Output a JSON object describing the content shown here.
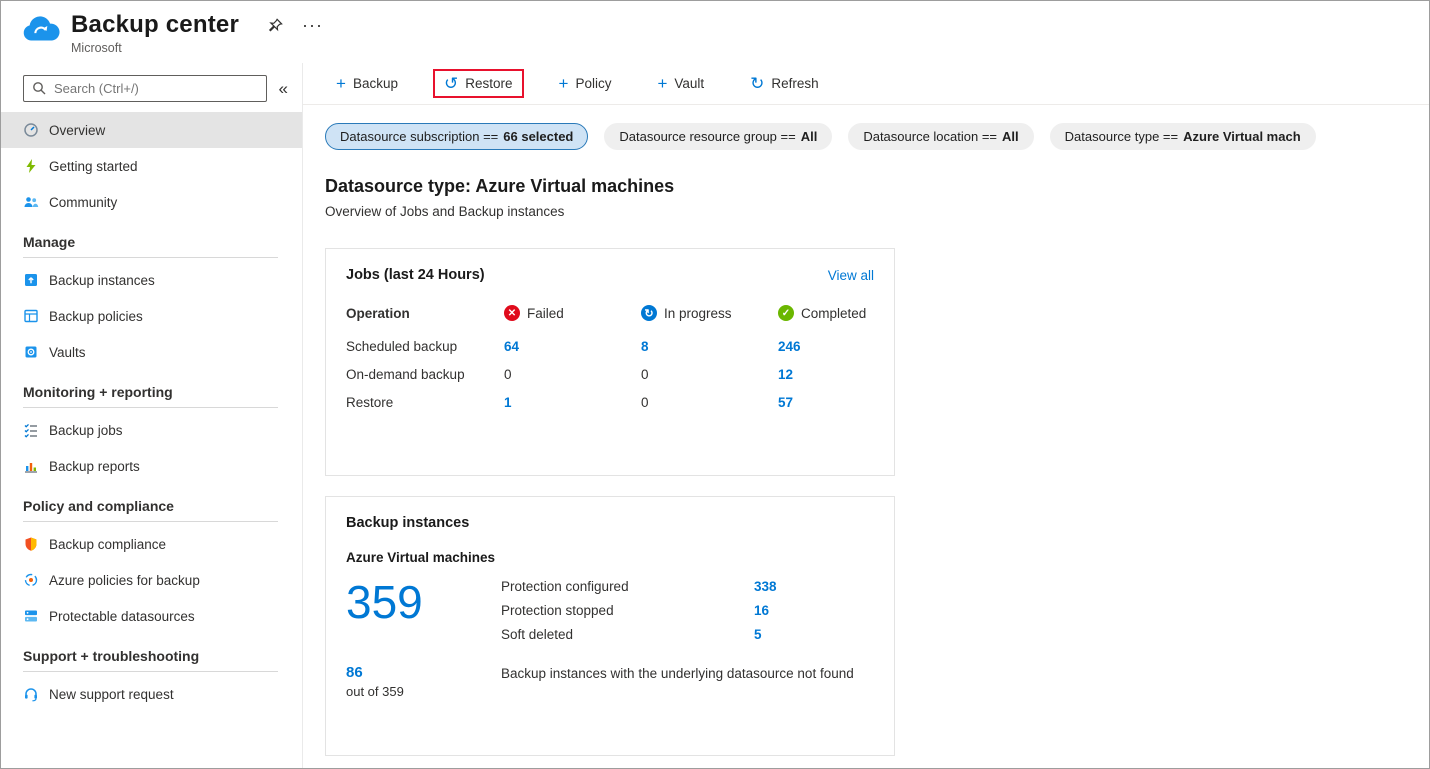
{
  "page": {
    "title": "Backup center",
    "publisher": "Microsoft"
  },
  "icons": {
    "plus": "+",
    "restore": "↺",
    "refresh": "↻",
    "collapse": "«",
    "more": "···",
    "failed_glyph": "✕",
    "in_progress_glyph": "↻",
    "completed_glyph": "✓"
  },
  "sidebar": {
    "search": {
      "placeholder": "Search (Ctrl+/)"
    },
    "items": [
      {
        "label": "Overview"
      },
      {
        "label": "Getting started"
      },
      {
        "label": "Community"
      }
    ],
    "groups": [
      {
        "heading": "Manage",
        "items": [
          {
            "label": "Backup instances"
          },
          {
            "label": "Backup policies"
          },
          {
            "label": "Vaults"
          }
        ]
      },
      {
        "heading": "Monitoring + reporting",
        "items": [
          {
            "label": "Backup jobs"
          },
          {
            "label": "Backup reports"
          }
        ]
      },
      {
        "heading": "Policy and compliance",
        "items": [
          {
            "label": "Backup compliance"
          },
          {
            "label": "Azure policies for backup"
          },
          {
            "label": "Protectable datasources"
          }
        ]
      },
      {
        "heading": "Support + troubleshooting",
        "items": [
          {
            "label": "New support request"
          }
        ]
      }
    ]
  },
  "toolbar": {
    "items": [
      {
        "label": "Backup"
      },
      {
        "label": "Restore"
      },
      {
        "label": "Policy"
      },
      {
        "label": "Vault"
      },
      {
        "label": "Refresh"
      }
    ]
  },
  "filters": [
    {
      "label": "Datasource subscription ==",
      "value": "66 selected",
      "selected": true
    },
    {
      "label": "Datasource resource group ==",
      "value": "All",
      "selected": false
    },
    {
      "label": "Datasource location ==",
      "value": "All",
      "selected": false
    },
    {
      "label": "Datasource type ==",
      "value": "Azure Virtual mach",
      "selected": false
    }
  ],
  "main": {
    "heading": "Datasource type: Azure Virtual machines",
    "subheading": "Overview of Jobs and Backup instances",
    "jobs": {
      "title": "Jobs (last 24 Hours)",
      "view_all": "View all",
      "col_operation": "Operation",
      "col_failed": "Failed",
      "col_in_progress": "In progress",
      "col_completed": "Completed",
      "rows": [
        {
          "operation": "Scheduled backup",
          "failed": "64",
          "in_progress": "8",
          "completed": "246"
        },
        {
          "operation": "On-demand backup",
          "failed": "0",
          "in_progress": "0",
          "completed": "12"
        },
        {
          "operation": "Restore",
          "failed": "1",
          "in_progress": "0",
          "completed": "57"
        }
      ]
    },
    "instances": {
      "title": "Backup instances",
      "subtitle": "Azure Virtual machines",
      "total": "359",
      "stats": [
        {
          "label": "Protection configured",
          "value": "338"
        },
        {
          "label": "Protection stopped",
          "value": "16"
        },
        {
          "label": "Soft deleted",
          "value": "5"
        }
      ],
      "missing": {
        "count": "86",
        "of": "out of 359",
        "label": "Backup instances with the underlying datasource not found"
      }
    }
  },
  "colors": {
    "accent": "#0078d4",
    "failed": "#e00b1c",
    "in_progress": "#0078d4",
    "completed": "#6bb700",
    "restore_highlight": "#e8112d",
    "sidebar_selected": "#e4e4e4"
  }
}
